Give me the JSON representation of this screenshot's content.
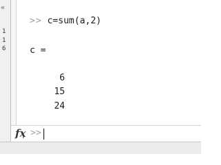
{
  "left_pane": {
    "chevron": "«",
    "line_numbers": [
      "1",
      "1",
      "6"
    ]
  },
  "command_window": {
    "prompt": ">>",
    "command": "c=sum(a,2)",
    "output_var": "c =",
    "values": [
      "6",
      "15",
      "24"
    ]
  },
  "input_bar": {
    "fx_label": "fx",
    "dropdown_glyph": "▾",
    "prompt": ">>"
  }
}
